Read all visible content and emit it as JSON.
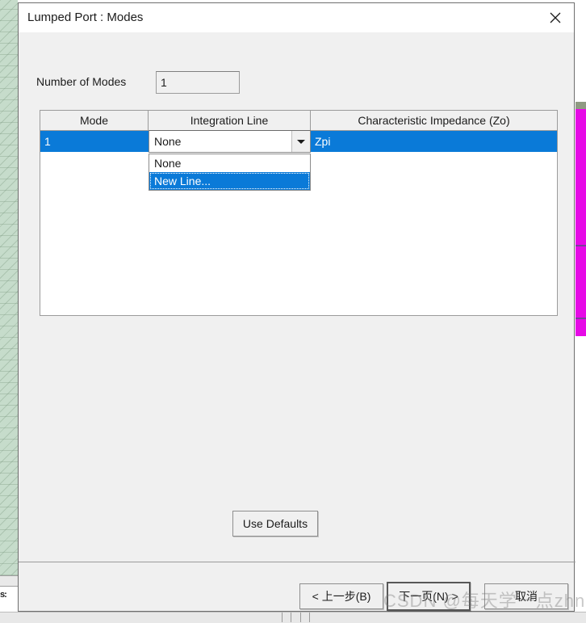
{
  "dialog": {
    "title": "Lumped Port : Modes",
    "close_icon": "close-icon"
  },
  "modes": {
    "label": "Number of Modes",
    "value": "1",
    "placeholder": ""
  },
  "table": {
    "headers": [
      "Mode",
      "Integration Line",
      "Characteristic Impedance (Zo)"
    ],
    "rows": [
      {
        "mode": "1",
        "integration_line": "None",
        "characteristic_impedance": "Zpi"
      }
    ]
  },
  "combobox": {
    "value": "None",
    "arrow_icon": "chevron-down-icon",
    "options": [
      "None",
      "New Line..."
    ],
    "highlighted": "New Line..."
  },
  "buttons": {
    "use_defaults": "Use Defaults",
    "back": "< 上一步(B)",
    "next": "下一页(N) >",
    "cancel": "取消"
  },
  "watermark": {
    "text": "CSDN @每天学一点zhn"
  },
  "background": {
    "left_fragment": "s:",
    "accent_blue": "#0a7ad8",
    "magenta": "#e60ae6",
    "dialog_face": "#f0f0f0"
  }
}
